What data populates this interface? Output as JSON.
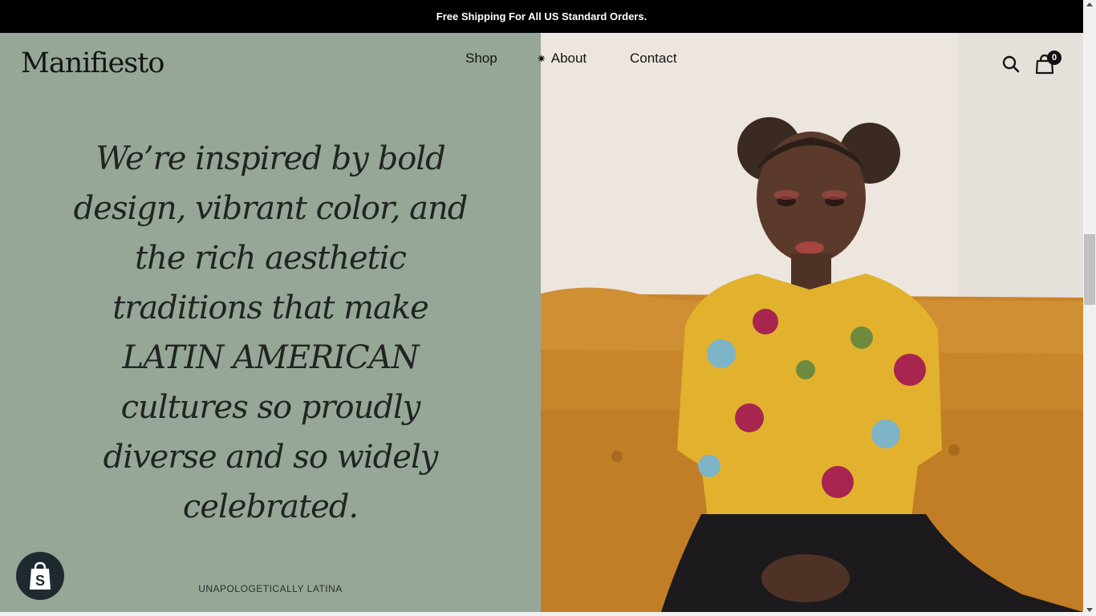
{
  "announcement": {
    "text": "Free Shipping For All US Standard Orders."
  },
  "header": {
    "logo": "Manifiesto",
    "nav": [
      {
        "label": "Shop"
      },
      {
        "label": "About",
        "icon": "asterisk-star-icon"
      },
      {
        "label": "Contact"
      }
    ],
    "cart_count": "0"
  },
  "hero": {
    "quote": "We’re inspired by bold design, vibrant color, and the rich aesthetic traditions that make LATIN AMERICAN cultures so proudly diverse and so widely celebrated.",
    "tagline": "UNAPOLOGETICALLY LATINA",
    "left_bg_color": "#96a797"
  },
  "icons": [
    "search-icon",
    "shopping-bag-icon",
    "shopify-bag-icon"
  ]
}
